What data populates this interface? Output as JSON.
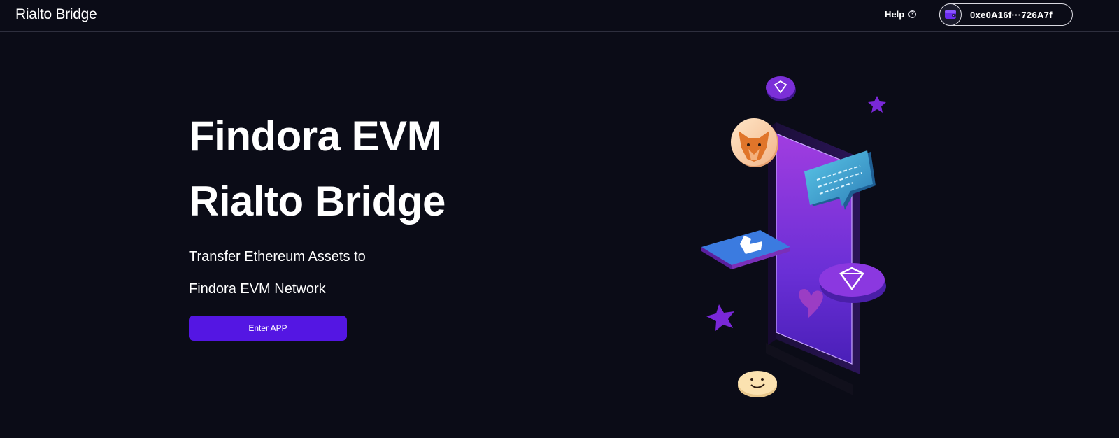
{
  "header": {
    "brand": "Rialto Bridge",
    "help_label": "Help",
    "help_icon": "question-circle-icon",
    "wallet_icon": "wallet-icon",
    "wallet_address": "0xe0A16f···726A7f"
  },
  "hero": {
    "title_line1": "Findora EVM",
    "title_line2": "Rialto Bridge",
    "subtitle_line1": "Transfer Ethereum Assets to",
    "subtitle_line2": "Findora EVM Network",
    "cta_label": "Enter APP"
  },
  "colors": {
    "background": "#0b0c17",
    "accent": "#5416e3",
    "text": "#ffffff"
  }
}
